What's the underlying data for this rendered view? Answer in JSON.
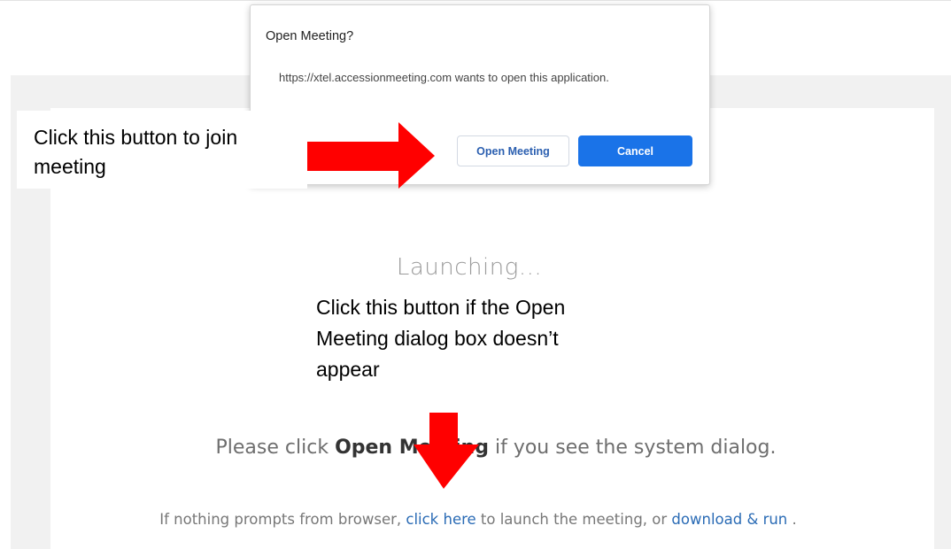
{
  "dialog": {
    "title": "Open Meeting?",
    "message": "https://xtel.accessionmeeting.com wants to open this application.",
    "open_button": "Open Meeting",
    "cancel_button": "Cancel"
  },
  "page": {
    "launching": "Launching...",
    "prompt_before": "Please click ",
    "prompt_bold": "Open Meeting",
    "prompt_after": " if you see the system dialog.",
    "fallback_before": "If nothing prompts from browser, ",
    "click_here": "click here",
    "fallback_middle": " to launch the meeting, or ",
    "download_run": "download & run",
    "fallback_after": " ."
  },
  "annotations": {
    "callout_join": "Click this button to join meeting",
    "callout_fallback": "Click this button if the Open Meeting dialog box doesn’t appear",
    "arrow_color": "#ff0000"
  },
  "colors": {
    "primary_button": "#1a73e8",
    "link": "#2a6bb5"
  }
}
